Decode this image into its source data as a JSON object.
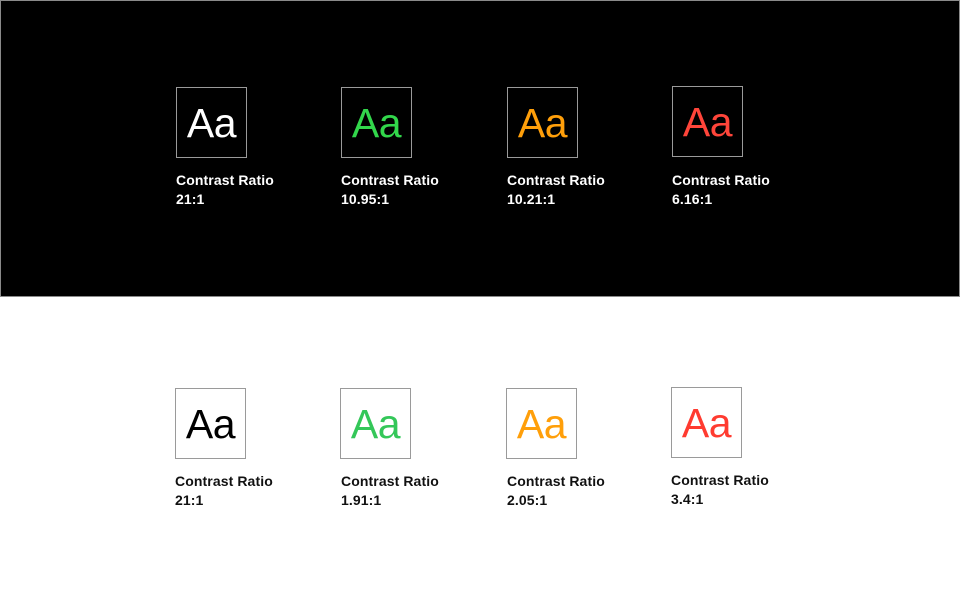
{
  "dark_section": {
    "background": "#000000",
    "swatches": [
      {
        "glyph": "Aa",
        "color": "#ffffff",
        "caption": "Contrast Ratio",
        "ratio": "21:1"
      },
      {
        "glyph": "Aa",
        "color": "#32d74b",
        "caption": "Contrast Ratio",
        "ratio": "10.95:1"
      },
      {
        "glyph": "Aa",
        "color": "#ff9f0a",
        "caption": "Contrast Ratio",
        "ratio": "10.21:1"
      },
      {
        "glyph": "Aa",
        "color": "#ff453a",
        "caption": "Contrast Ratio",
        "ratio": "6.16:1"
      }
    ]
  },
  "light_section": {
    "background": "#ffffff",
    "swatches": [
      {
        "glyph": "Aa",
        "color": "#000000",
        "caption": "Contrast Ratio",
        "ratio": "21:1"
      },
      {
        "glyph": "Aa",
        "color": "#34c759",
        "caption": "Contrast Ratio",
        "ratio": "1.91:1"
      },
      {
        "glyph": "Aa",
        "color": "#ff9f0a",
        "caption": "Contrast Ratio",
        "ratio": "2.05:1"
      },
      {
        "glyph": "Aa",
        "color": "#ff3b30",
        "caption": "Contrast Ratio",
        "ratio": "3.4:1"
      }
    ]
  }
}
